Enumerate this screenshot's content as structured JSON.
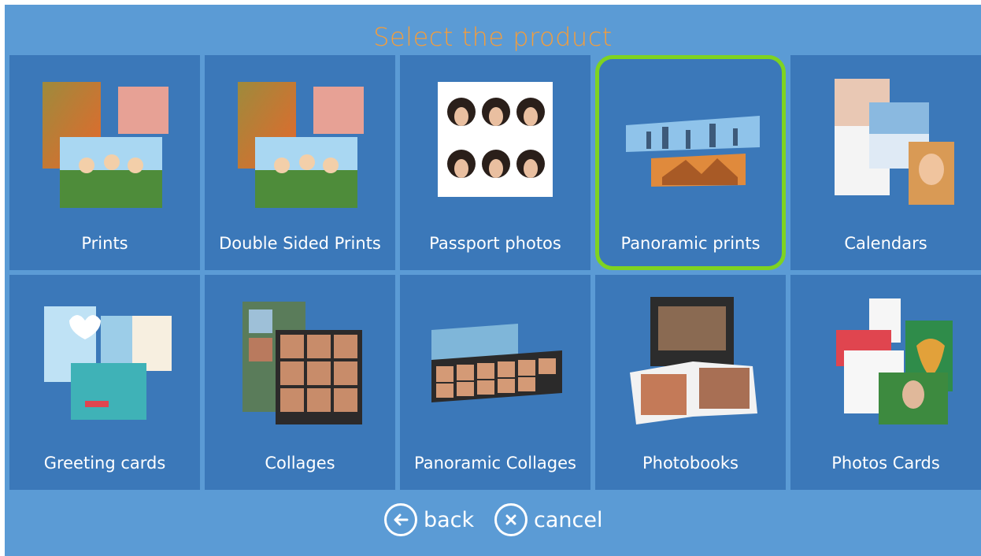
{
  "header": {
    "title": "Select the product"
  },
  "products": [
    {
      "label": "Prints",
      "icon": "prints-icon"
    },
    {
      "label": "Double Sided Prints",
      "icon": "double-sided-prints-icon"
    },
    {
      "label": "Passport photos",
      "icon": "passport-photos-icon"
    },
    {
      "label": "Panoramic prints",
      "icon": "panoramic-prints-icon",
      "selected": true
    },
    {
      "label": "Calendars",
      "icon": "calendars-icon"
    },
    {
      "label": "Greeting cards",
      "icon": "greeting-cards-icon"
    },
    {
      "label": "Collages",
      "icon": "collages-icon"
    },
    {
      "label": "Panoramic Collages",
      "icon": "panoramic-collages-icon"
    },
    {
      "label": "Photobooks",
      "icon": "photobooks-icon"
    },
    {
      "label": "Photos Cards",
      "icon": "photo-cards-icon"
    }
  ],
  "footer": {
    "back_label": "back",
    "cancel_label": "cancel"
  },
  "colors": {
    "background": "#5b9bd5",
    "tile": "#3b78b9",
    "title": "#f59d3a",
    "selection": "#7ed321"
  }
}
